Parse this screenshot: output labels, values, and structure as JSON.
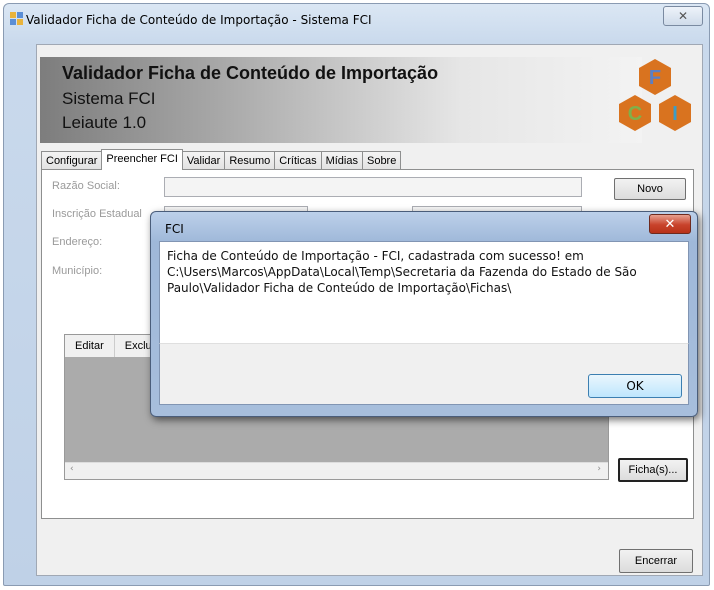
{
  "window": {
    "title": "Validador Ficha de Conteúdo de Importação - Sistema FCI",
    "close_glyph": "✕"
  },
  "banner": {
    "title": "Validador Ficha de Conteúdo de Importação",
    "subtitle": "Sistema FCI",
    "layout": "Leiaute 1.0",
    "logo_letters": [
      "F",
      "C",
      "I"
    ],
    "logo_colors": {
      "F": "#5b7fc4",
      "C": "#7fb04a",
      "I": "#3d9cc4",
      "hex_fill": "#d9731f"
    }
  },
  "tabs": [
    {
      "label": "Configurar"
    },
    {
      "label": "Preencher FCI",
      "active": true
    },
    {
      "label": "Validar"
    },
    {
      "label": "Resumo"
    },
    {
      "label": "Críticas"
    },
    {
      "label": "Mídias"
    },
    {
      "label": "Sobre"
    }
  ],
  "form": {
    "razao_social_label": "Razão Social:",
    "inscricao_label": "Inscrição Estadual",
    "endereco_label": "Endereço:",
    "municipio_label": "Município:",
    "novo_button": "Novo",
    "grid_headers": [
      "Editar",
      "Excluir"
    ],
    "scroll_left": "‹",
    "scroll_right": "›",
    "fichas_button": "Ficha(s)..."
  },
  "footer": {
    "encerrar_button": "Encerrar"
  },
  "dialog": {
    "title": "FCI",
    "close_glyph": "✕",
    "message_line1": "Ficha de Conteúdo de Importação - FCI, cadastrada com sucesso! em",
    "message_line2": "C:\\Users\\Marcos\\AppData\\Local\\Temp\\Secretaria da Fazenda do Estado de São",
    "message_line3": "Paulo\\Validador Ficha de Conteúdo de Importação\\Fichas\\",
    "ok_button": "OK"
  }
}
